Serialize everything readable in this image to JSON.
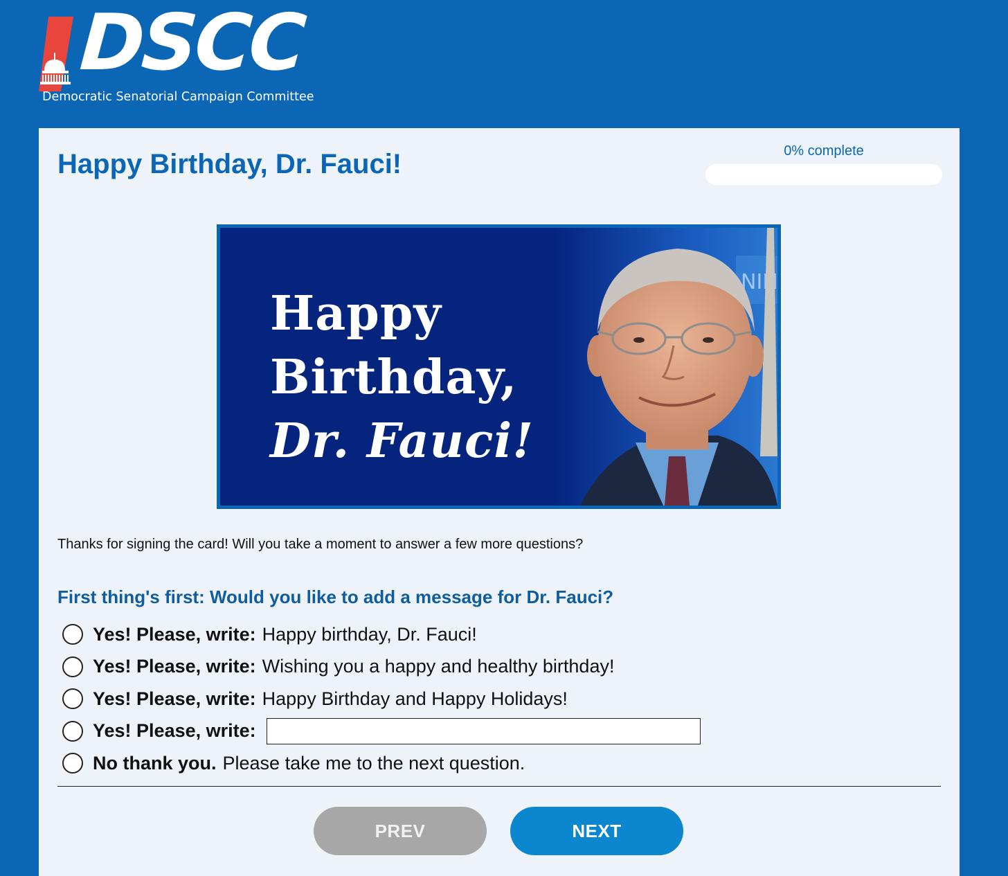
{
  "header": {
    "logo_text": "DSCC",
    "logo_subtitle": "Democratic Senatorial Campaign Committee"
  },
  "card": {
    "title": "Happy Birthday, Dr. Fauci!",
    "progress": {
      "label": "0% complete",
      "percent": 0
    },
    "banner": {
      "line1": "Happy",
      "line2": "Birthday,",
      "line3": "Dr. Fauci!",
      "background_text": "NIH"
    },
    "intro": "Thanks for signing the card! Will you take a moment to answer a few more questions?",
    "question": "First thing's first: Would you like to add a message for Dr. Fauci?",
    "options": [
      {
        "bold": "Yes! Please, write:",
        "text": "Happy birthday, Dr. Fauci!"
      },
      {
        "bold": "Yes! Please, write:",
        "text": "Wishing you a happy and healthy birthday!"
      },
      {
        "bold": "Yes! Please, write:",
        "text": "Happy Birthday and Happy Holidays!"
      },
      {
        "bold": "Yes! Please, write:",
        "input_value": ""
      },
      {
        "bold": "No thank you.",
        "text": "Please take me to the next question."
      }
    ],
    "buttons": {
      "prev": "PREV",
      "next": "NEXT"
    }
  },
  "colors": {
    "brand_blue": "#0b67b5",
    "banner_navy": "#05247e",
    "next_button": "#0b86cf",
    "prev_button": "#a7a7a7",
    "logo_red": "#e8453c"
  }
}
